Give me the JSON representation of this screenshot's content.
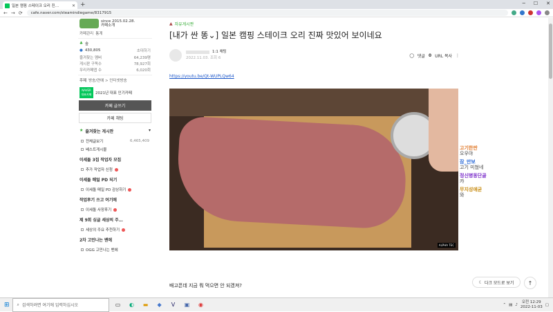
{
  "browser": {
    "tab_title": "일본 캠핑 스테이크 오리 진…",
    "url": "cafe.naver.com/steamindiegame/8317915"
  },
  "sidebar": {
    "since": "since 2015.02.28.",
    "cafe_intro": "카페소개",
    "manage": "카페관리",
    "stats": "통계",
    "rank": "숲",
    "members": "430,805",
    "invite": "초대하기",
    "fav_boards_label": "즐겨찾는 멤버",
    "fav_boards_count": "64,239명",
    "posts_label": "게시판 구독수",
    "posts_count": "78,927회",
    "visits_label": "우리카페앱 수",
    "visits_count": "6,020회",
    "topic": "주제",
    "topic_val": "방송/연예 > 인터넷방송",
    "badge_label": "NAVER 대표카페",
    "badge_year": "2021년 대표 인기카페",
    "write_btn": "카페 글쓰기",
    "chat_btn": "카페 채팅",
    "fav_boards": "즐겨찾는 게시판",
    "all_posts": "전체글보기",
    "all_count": "6,465,409",
    "best": "베스트게시물",
    "sec1": "이세돌 3집 작업자 모집",
    "sec1_item": "추가 작업자 신청",
    "sec2": "이세돌 매일 PD 되기",
    "sec2_item": "이세돌 매일 PD 감상하기",
    "sec3": "작업후기 쓰고 여기에",
    "sec3_item": "이세돌 사장후기",
    "sec4": "제 9회 싱글 세상의 주…",
    "sec4_item": "세상의 주요 추천하기",
    "sec5": "2차 고민나는 밴에",
    "sec5_item": "OGG 고민나는 밴에"
  },
  "post": {
    "category": "자유게시판",
    "title": "[내가 싼 똥⌄] 일본 캠핑 스테이크 오리 진짜 맛있어 보이네요",
    "author_level": "1:1 채팅",
    "meta": "2022.11.03. 조회 6",
    "comment_label": "댓글",
    "comment_count": "0",
    "url_copy": "URL 복사",
    "link": "https://youtu.be/Qt-WUPLQw64",
    "video_tag": "ALPHA TEC",
    "body": "배고픈데 지금 뭐 먹으면 안 되겠져?"
  },
  "chat": [
    {
      "name": "고기한판",
      "msg": "오우야",
      "color": "#e07a2c"
    },
    {
      "name": "잠_만보",
      "msg": "고기 미쳤네",
      "color": "#2c6ad6"
    },
    {
      "name": "정신병동단골",
      "msg": "캬",
      "color": "#7a2cc9"
    },
    {
      "name": "무지성애굳",
      "msg": "와",
      "color": "#c78b12"
    }
  ],
  "dark_mode": "다크 모드로 보기",
  "taskbar": {
    "search_placeholder": "검색하려면 여기에 입력하십시오",
    "time": "오전 12:29",
    "date": "2022-11-03"
  }
}
